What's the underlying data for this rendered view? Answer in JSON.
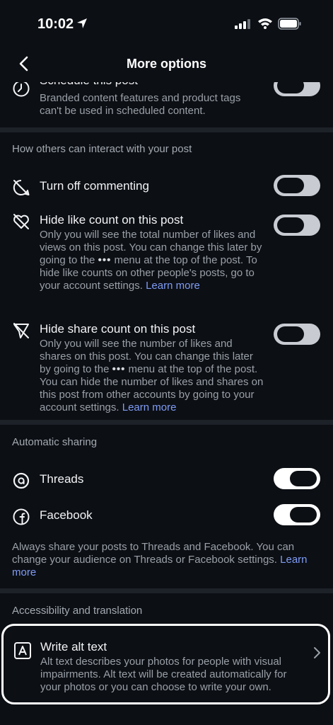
{
  "status_bar": {
    "time": "10:02"
  },
  "nav": {
    "title": "More options"
  },
  "schedule_row": {
    "title": "Schedule this post",
    "description": "Branded content features and product tags can't be used in scheduled content.",
    "toggle_state": "off"
  },
  "interaction_section": {
    "header": "How others can interact with your post",
    "comments": {
      "title": "Turn off commenting",
      "toggle_state": "off"
    },
    "like_count": {
      "title": "Hide like count on this post",
      "desc_before": "Only you will see the total number of likes and views on this post. You can change this later by going to the",
      "dots": "•••",
      "desc_after": "menu at the top of the post. To hide like counts on other people's posts, go to your account settings.",
      "link": "Learn more",
      "toggle_state": "off"
    },
    "share_count": {
      "title": "Hide share count on this post",
      "desc_before": "Only you will see the number of likes and shares on this post. You can change this later by going to the",
      "dots": "•••",
      "desc_after": "menu at the top of the post. You can hide the number of likes and shares on this post from other accounts by going to your account settings.",
      "link": "Learn more",
      "toggle_state": "off"
    }
  },
  "sharing_section": {
    "header": "Automatic sharing",
    "threads": {
      "title": "Threads",
      "toggle_state": "on"
    },
    "facebook": {
      "title": "Facebook",
      "toggle_state": "on"
    },
    "note": "Always share your posts to Threads and Facebook. You can change your audience on Threads or Facebook settings.",
    "note_link": "Learn more"
  },
  "accessibility_section": {
    "header": "Accessibility and translation",
    "alt_text": {
      "title": "Write alt text",
      "description": "Alt text describes your photos for people with visual impairments. Alt text will be created automatically for your photos or you can choose to write your own."
    }
  }
}
